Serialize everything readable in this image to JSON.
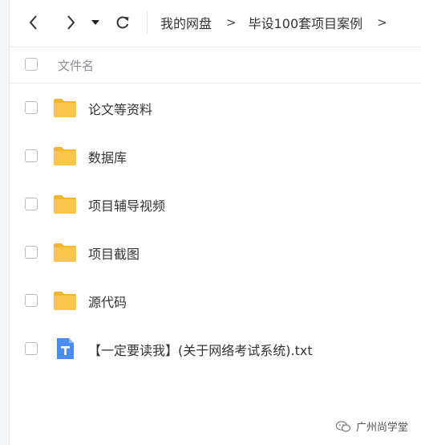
{
  "toolbar": {
    "back_icon": "chevron-left-icon",
    "forward_icon": "chevron-right-icon",
    "history_icon": "caret-down-icon",
    "refresh_icon": "refresh-icon"
  },
  "breadcrumb": {
    "items": [
      "我的网盘",
      "毕设100套项目案例"
    ],
    "separator": ">"
  },
  "header": {
    "name_column": "文件名"
  },
  "files": [
    {
      "name": "论文等资料",
      "type": "folder"
    },
    {
      "name": "数据库",
      "type": "folder"
    },
    {
      "name": "项目辅导视频",
      "type": "folder"
    },
    {
      "name": "项目截图",
      "type": "folder"
    },
    {
      "name": "源代码",
      "type": "folder"
    },
    {
      "name": "【一定要读我】(关于网络考试系统).txt",
      "type": "txt"
    }
  ],
  "colors": {
    "folder": "#f8c74a",
    "folder_tab": "#f2b72f",
    "txt_doc": "#4a8cf0"
  },
  "watermark": {
    "text": "广州尚学堂",
    "icon": "wechat-icon"
  }
}
